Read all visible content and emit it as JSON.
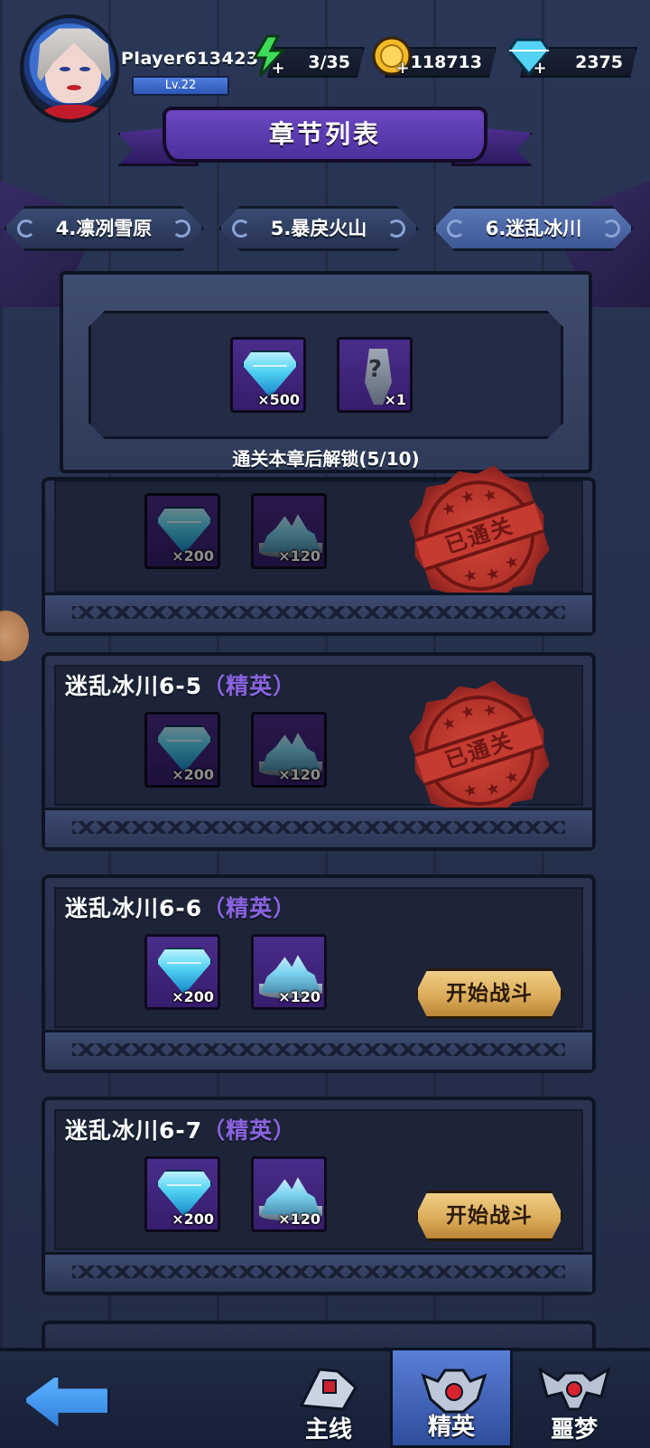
{
  "player": {
    "name": "Player613423",
    "level": "Lv.22"
  },
  "resources": {
    "energy": {
      "icon": "lightning-icon",
      "value": "3/35"
    },
    "gold": {
      "icon": "gold-coin-icon",
      "value": "118713"
    },
    "gems": {
      "icon": "diamond-icon",
      "value": "2375"
    }
  },
  "title": "章节列表",
  "tabs": [
    {
      "label": "4.凛冽雪原",
      "active": false
    },
    {
      "label": "5.暴戾火山",
      "active": false
    },
    {
      "label": "6.迷乱冰川",
      "active": true
    }
  ],
  "chapter_reward": {
    "items": [
      {
        "icon": "diamond-icon",
        "qty": "×500"
      },
      {
        "icon": "mystery-weapon-icon",
        "qty": "×1"
      }
    ],
    "unlock_text": "通关本章后解锁(5/10)"
  },
  "stages": [
    {
      "title": "",
      "tag": "",
      "rewards": [
        {
          "icon": "diamond-icon",
          "qty": "×200"
        },
        {
          "icon": "ice-ore-icon",
          "qty": "×120"
        }
      ],
      "cleared": true,
      "stamp_text": "已通关"
    },
    {
      "title": "迷乱冰川6-5",
      "tag": "（精英）",
      "rewards": [
        {
          "icon": "diamond-icon",
          "qty": "×200"
        },
        {
          "icon": "ice-ore-icon",
          "qty": "×120"
        }
      ],
      "cleared": true,
      "stamp_text": "已通关"
    },
    {
      "title": "迷乱冰川6-6",
      "tag": "（精英）",
      "rewards": [
        {
          "icon": "diamond-icon",
          "qty": "×200"
        },
        {
          "icon": "ice-ore-icon",
          "qty": "×120"
        }
      ],
      "cleared": false,
      "button": "开始战斗"
    },
    {
      "title": "迷乱冰川6-7",
      "tag": "（精英）",
      "rewards": [
        {
          "icon": "diamond-icon",
          "qty": "×200"
        },
        {
          "icon": "ice-ore-icon",
          "qty": "×120"
        }
      ],
      "cleared": false,
      "button": "开始战斗"
    }
  ],
  "bottom_nav": [
    {
      "label": "主线",
      "icon": "main-line-icon",
      "active": false
    },
    {
      "label": "精英",
      "icon": "elite-skull-icon",
      "active": true
    },
    {
      "label": "噩梦",
      "icon": "nightmare-bat-icon",
      "active": false
    }
  ],
  "colors": {
    "background": "#26314f",
    "banner": "#5a3aad",
    "elite_tag": "#8a63e0",
    "stamp": "#b3332a",
    "fight_button": "#d9a957",
    "active_tab": "#4a66a8"
  }
}
